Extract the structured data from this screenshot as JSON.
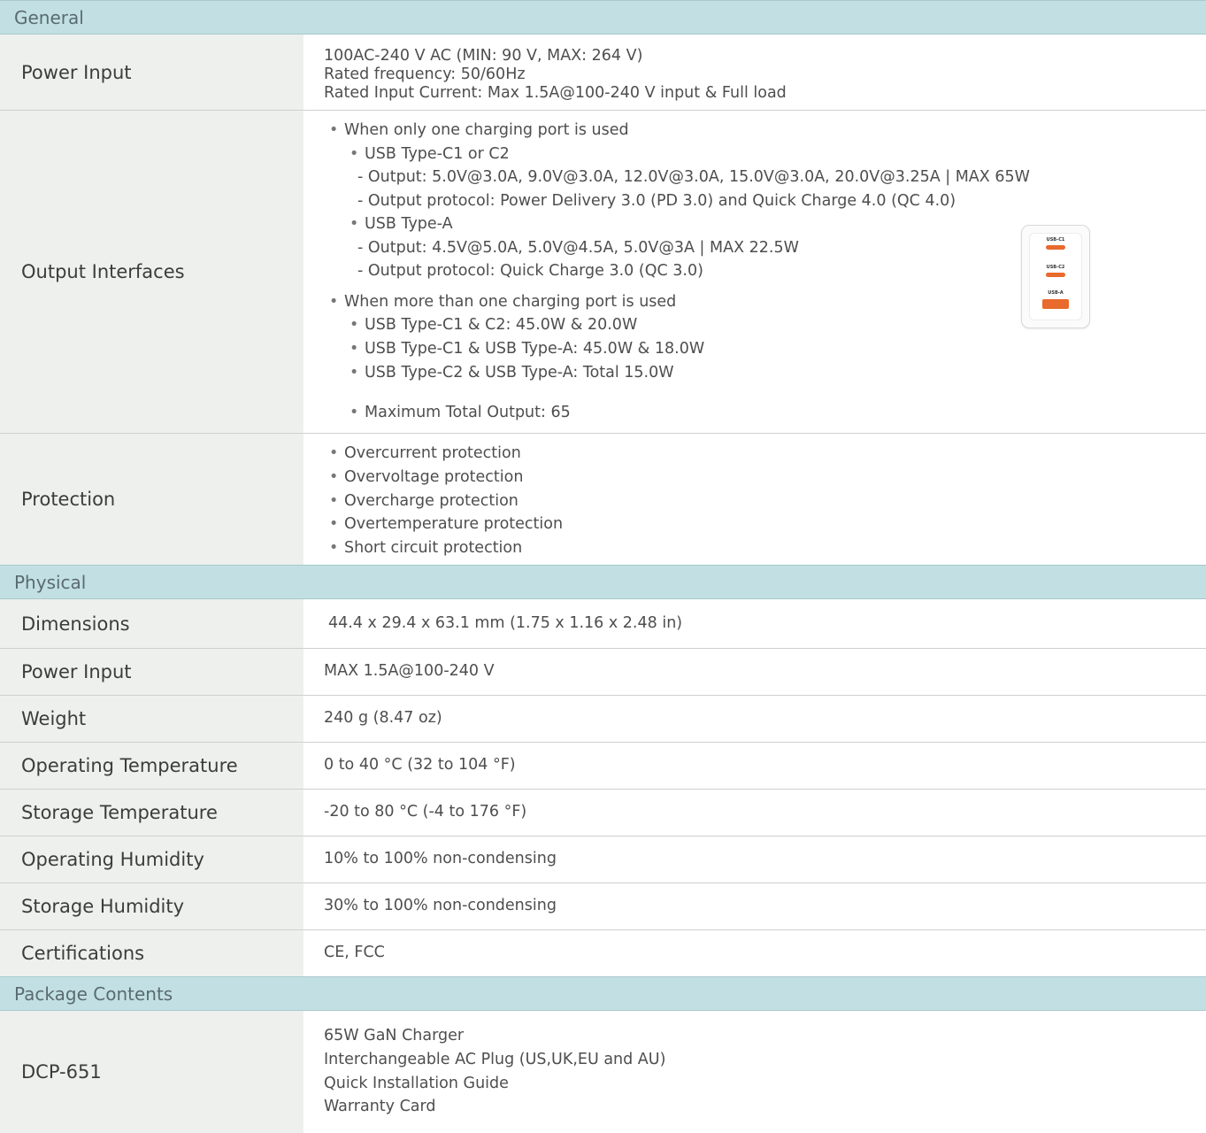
{
  "sections": {
    "general": "General",
    "physical": "Physical",
    "package": "Package Contents"
  },
  "general": {
    "power_input": {
      "label": "Power Input",
      "lines": [
        "100AC-240 V AC (MIN: 90 V, MAX: 264 V)",
        "Rated frequency: 50/60Hz",
        "Rated Input Current: Max 1.5A@100-240 V input & Full load"
      ]
    },
    "output": {
      "label": "Output Interfaces",
      "lines": [
        "When only one charging port is used",
        "USB Type-C1 or C2",
        "- Output: 5.0V@3.0A, 9.0V@3.0A, 12.0V@3.0A, 15.0V@3.0A, 20.0V@3.25A | MAX 65W",
        "- Output protocol: Power Delivery 3.0 (PD 3.0) and Quick Charge 4.0 (QC 4.0)",
        "USB Type-A",
        "- Output: 4.5V@5.0A, 5.0V@4.5A, 5.0V@3A | MAX 22.5W",
        "- Output protocol: Quick Charge 3.0 (QC 3.0)",
        "When more than one charging port is used",
        "USB Type-C1 & C2: 45.0W & 20.0W",
        "USB Type-C1 & USB Type-A: 45.0W & 18.0W",
        "USB Type-C2 & USB Type-A: Total 15.0W",
        "Maximum Total Output: 65"
      ],
      "ports": [
        "USB-C1",
        "USB-C2",
        "USB-A"
      ],
      "port_color": "#e86a2c"
    },
    "protection": {
      "label": "Protection",
      "lines": [
        "Overcurrent protection",
        "Overvoltage protection",
        "Overcharge protection",
        "Overtemperature protection",
        "Short circuit protection"
      ]
    }
  },
  "physical": [
    {
      "label": "Dimensions",
      "value": "44.4 x 29.4 x 63.1 mm (1.75 x 1.16 x 2.48 in)"
    },
    {
      "label": "Power Input",
      "value": "MAX 1.5A@100-240 V"
    },
    {
      "label": "Weight",
      "value": "240 g (8.47 oz)"
    },
    {
      "label": "Operating Temperature",
      "value": "0 to 40 °C (32 to 104 °F)"
    },
    {
      "label": "Storage Temperature",
      "value": "-20 to 80 °C (-4 to 176 °F)"
    },
    {
      "label": "Operating Humidity",
      "value": "10% to 100% non-condensing"
    },
    {
      "label": "Storage Humidity",
      "value": "30% to 100% non-condensing"
    },
    {
      "label": "Certifications",
      "value": "CE, FCC"
    }
  ],
  "package": {
    "label": "DCP-651",
    "lines": [
      "65W GaN Charger",
      "Interchangeable AC Plug (US,UK,EU and AU)",
      "Quick Installation Guide",
      "Warranty Card"
    ]
  },
  "colors": {
    "section_bg": "#c2e0e3",
    "label_bg": "#eef0ee"
  }
}
